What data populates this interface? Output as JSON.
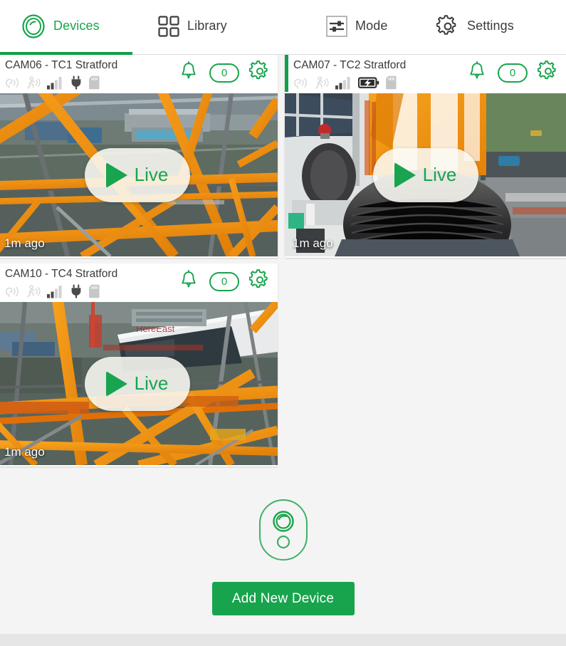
{
  "colors": {
    "brand_green": "#17a44c",
    "accent_green": "#0fa04a",
    "text_dark": "#3a3a3a",
    "page_bg": "#f4f4f4",
    "card_bg": "#ffffff",
    "bottom_bar": "#e6e6e6"
  },
  "tabs": [
    {
      "label": "Devices",
      "icon": "device-lens-icon",
      "active": true
    },
    {
      "label": "Library",
      "icon": "grid-squares-icon",
      "active": false
    },
    {
      "label": "Mode",
      "icon": "sliders-icon",
      "active": false
    },
    {
      "label": "Settings",
      "icon": "gear-icon",
      "active": false
    }
  ],
  "cards": [
    {
      "title": "CAM06 - TC1 Stratford",
      "notification_count": "0",
      "timestamp": "1m ago",
      "live_label": "Live",
      "accent": false,
      "status": {
        "audio": "off",
        "motion": "off",
        "signal_bars": 2,
        "signal_total": 4,
        "power": "plug",
        "storage": "sd-card"
      }
    },
    {
      "title": "CAM07 - TC2 Stratford",
      "notification_count": "0",
      "timestamp": "1m ago",
      "live_label": "Live",
      "accent": true,
      "status": {
        "audio": "off",
        "motion": "off",
        "signal_bars": 2,
        "signal_total": 4,
        "power": "battery-charging",
        "storage": "sd-card"
      }
    },
    {
      "title": "CAM10 - TC4 Stratford",
      "notification_count": "0",
      "timestamp": "1m ago",
      "live_label": "Live",
      "accent": false,
      "status": {
        "audio": "off",
        "motion": "off",
        "signal_bars": 2,
        "signal_total": 4,
        "power": "plug",
        "storage": "sd-card"
      }
    }
  ],
  "add_device": {
    "icon": "camera-device-outline-icon",
    "button_label": "Add New Device"
  },
  "thumbnail_overlay_text": {
    "scene_label": "HereEast"
  }
}
